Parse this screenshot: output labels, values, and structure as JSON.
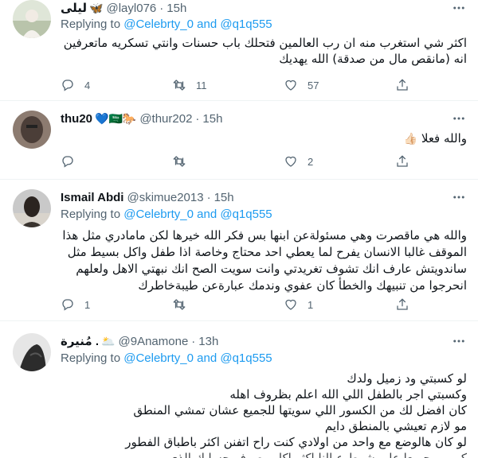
{
  "tweets": [
    {
      "name": "ليلى",
      "name_emoji": "🦋",
      "handle": "@layl076",
      "time": "15h",
      "replying_prefix": "Replying to",
      "replying_to": "@Celebrty_0 and @q1q555",
      "text_lines": [
        "اكثر شي استغرب منه ان رب العالمين فتحلك باب حسنات وانتي تسكريه ماتعرفين",
        "انه (مانقص مال من صدقة) الله يهديك"
      ],
      "replies": "4",
      "retweets": "11",
      "likes": "57",
      "avatar_color": "#a7b7a0"
    },
    {
      "name": "thu20",
      "name_emoji": "💙🇸🇦🐎",
      "handle": "@thur202",
      "time": "15h",
      "text_lines": [
        "والله فعلا"
      ],
      "text_emoji": "👍🏻",
      "replies": "",
      "retweets": "",
      "likes": "2",
      "avatar_color": "#5a4e48"
    },
    {
      "name": "Ismail Abdi",
      "handle": "@skimue2013",
      "time": "15h",
      "replying_prefix": "Replying to",
      "replying_to": "@Celebrty_0 and @q1q555",
      "text_lines": [
        "والله هي ماقصرت وهي مسئولةعن ابنها بس فكر الله خيرها  لكن مامادري مثل هذا",
        "الموقف غالبا الانسان يفرح لما يعطي احد محتاج وخاصة اذا طفل واكل بسيط مثل",
        "ساندويتش عارف انك تشوف تغريدتي وانت سويت الصح انك نبهتي الاهل ولعلهم",
        "انحرجوا من تنبيهك والخطأ كان عفوي وندمك عبارةعن طيبةخاطرك"
      ],
      "replies": "1",
      "retweets": "",
      "likes": "1",
      "avatar_color": "#3b3633"
    },
    {
      "name": "مُنيرة .",
      "name_emoji": "🌥️",
      "handle": "@9Anamone",
      "time": "13h",
      "replying_prefix": "Replying to",
      "replying_to": "@Celebrty_0 and @q1q555",
      "text_lines": [
        "لو كسبتي ود زميل ولدك",
        "وكسبتي اجر بالطفل اللي الله اعلم بظروف اهله",
        "كان افضل لك من الكسور اللي سويتها للجميع عشان تمشي المنطق",
        "مو لازم تعيشي بالمنطق دايم",
        "لو كان هالوضع مع واحد من اولادي كنت راح اتفنن اكثر باطباق الفطور",
        "كرمهم جميعا علي شرط عيالنا اكثر اكل مصرف حسابك الذي"
      ],
      "avatar_color": "#2f2f2f"
    }
  ],
  "icons": {
    "reply": "reply-icon",
    "retweet": "retweet-icon",
    "like": "heart-icon",
    "share": "share-icon",
    "more": "more-icon"
  }
}
